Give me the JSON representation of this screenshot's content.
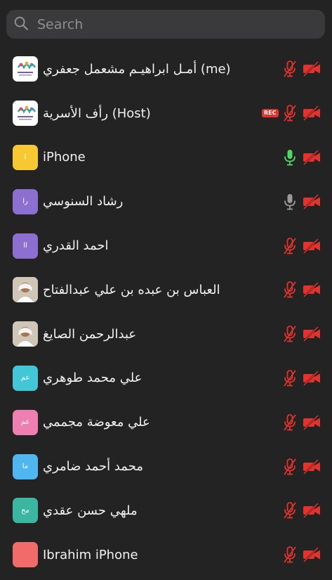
{
  "search": {
    "placeholder": "Search",
    "icon": "search-icon"
  },
  "colors": {
    "muted_red": "#e5322d",
    "active_green": "#4cd964",
    "idle_gray": "#9a9a9a"
  },
  "participants": [
    {
      "name": "أمـل ابراهيـم مشعمل جعفري (me)",
      "avatar": {
        "type": "logo",
        "text": "",
        "color": "#ffffff"
      },
      "mic": "muted",
      "camera": "off",
      "rec": ""
    },
    {
      "name": "رأف الأسرية (Host)",
      "avatar": {
        "type": "logo",
        "text": "",
        "color": "#ffffff"
      },
      "mic": "muted",
      "camera": "off",
      "rec": "REC"
    },
    {
      "name": "iPhone",
      "avatar": {
        "type": "initials",
        "text": "I",
        "color": "#f7c831"
      },
      "mic": "active",
      "camera": "off",
      "rec": ""
    },
    {
      "name": "رشاد السنوسي",
      "avatar": {
        "type": "initials",
        "text": "را",
        "color": "#8c6fd1"
      },
      "mic": "idle",
      "camera": "off",
      "rec": ""
    },
    {
      "name": "احمد القدري",
      "avatar": {
        "type": "initials",
        "text": "اا",
        "color": "#8c6fd1"
      },
      "mic": "muted",
      "camera": "off",
      "rec": ""
    },
    {
      "name": "العباس بن عبده بن علي عبدالفتاح",
      "avatar": {
        "type": "photo",
        "text": "",
        "color": "#d9d2c8"
      },
      "mic": "muted",
      "camera": "off",
      "rec": ""
    },
    {
      "name": "عبدالرحمن الصايغ",
      "avatar": {
        "type": "photo",
        "text": "",
        "color": "#d9d2c8"
      },
      "mic": "muted",
      "camera": "off",
      "rec": ""
    },
    {
      "name": "علي محمد طوهري",
      "avatar": {
        "type": "initials",
        "text": "عم",
        "color": "#43c7d6"
      },
      "mic": "muted",
      "camera": "off",
      "rec": ""
    },
    {
      "name": "علي معوضة مجممي",
      "avatar": {
        "type": "initials",
        "text": "عم",
        "color": "#ee7fb0"
      },
      "mic": "muted",
      "camera": "off",
      "rec": ""
    },
    {
      "name": "محمد أحمد ضامري",
      "avatar": {
        "type": "initials",
        "text": "ما",
        "color": "#4fb6ef"
      },
      "mic": "muted",
      "camera": "off",
      "rec": ""
    },
    {
      "name": "ملهي حسن عقدي",
      "avatar": {
        "type": "initials",
        "text": "مح",
        "color": "#3ab6a1"
      },
      "mic": "muted",
      "camera": "off",
      "rec": ""
    },
    {
      "name": "Ibrahim iPhone",
      "avatar": {
        "type": "initials",
        "text": "",
        "color": "#f26b6b"
      },
      "mic": "muted",
      "camera": "off",
      "rec": ""
    }
  ]
}
